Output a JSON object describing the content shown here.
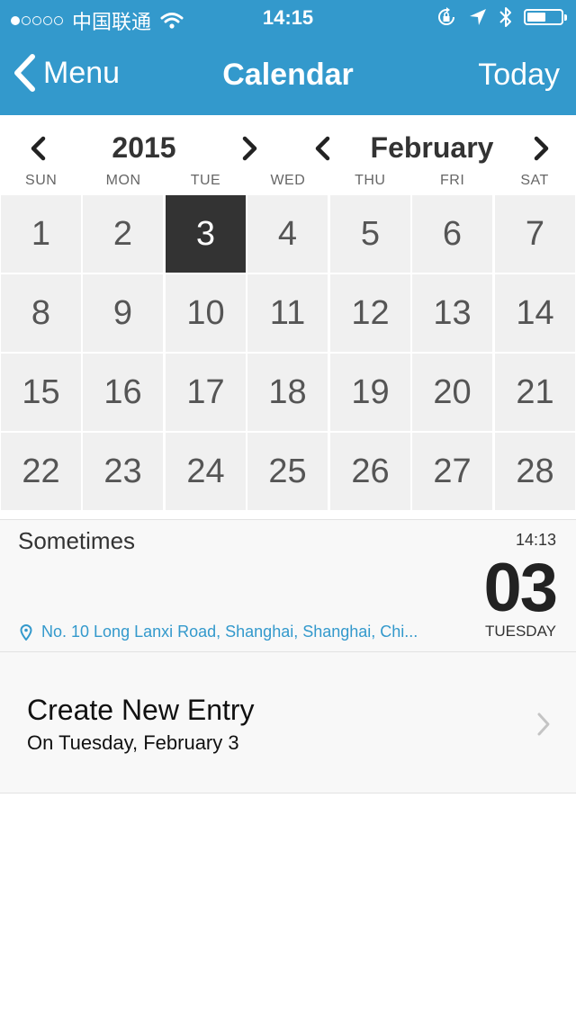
{
  "status_bar": {
    "carrier": "中国联通",
    "time": "14:15",
    "signal_dots_filled": 1,
    "signal_dots_total": 5,
    "battery_level": 0.55
  },
  "nav": {
    "back_label": "Menu",
    "title": "Calendar",
    "today_label": "Today"
  },
  "year_picker": {
    "value": "2015"
  },
  "month_picker": {
    "value": "February"
  },
  "weekdays": [
    "SUN",
    "MON",
    "TUE",
    "WED",
    "THU",
    "FRI",
    "SAT"
  ],
  "days": [
    "1",
    "2",
    "3",
    "4",
    "5",
    "6",
    "7",
    "8",
    "9",
    "10",
    "11",
    "12",
    "13",
    "14",
    "15",
    "16",
    "17",
    "18",
    "19",
    "20",
    "21",
    "22",
    "23",
    "24",
    "25",
    "26",
    "27",
    "28"
  ],
  "selected_day": "3",
  "entry": {
    "title": "Sometimes",
    "time": "14:13",
    "day": "03",
    "weekday": "TUESDAY",
    "location": "No. 10 Long Lanxi Road, Shanghai, Shanghai, Chi..."
  },
  "create": {
    "title": "Create New Entry",
    "subtitle": "On Tuesday, February 3"
  },
  "colors": {
    "accent": "#3399cc",
    "selected_day_bg": "#333333",
    "day_cell_bg": "#f0f0f0"
  }
}
